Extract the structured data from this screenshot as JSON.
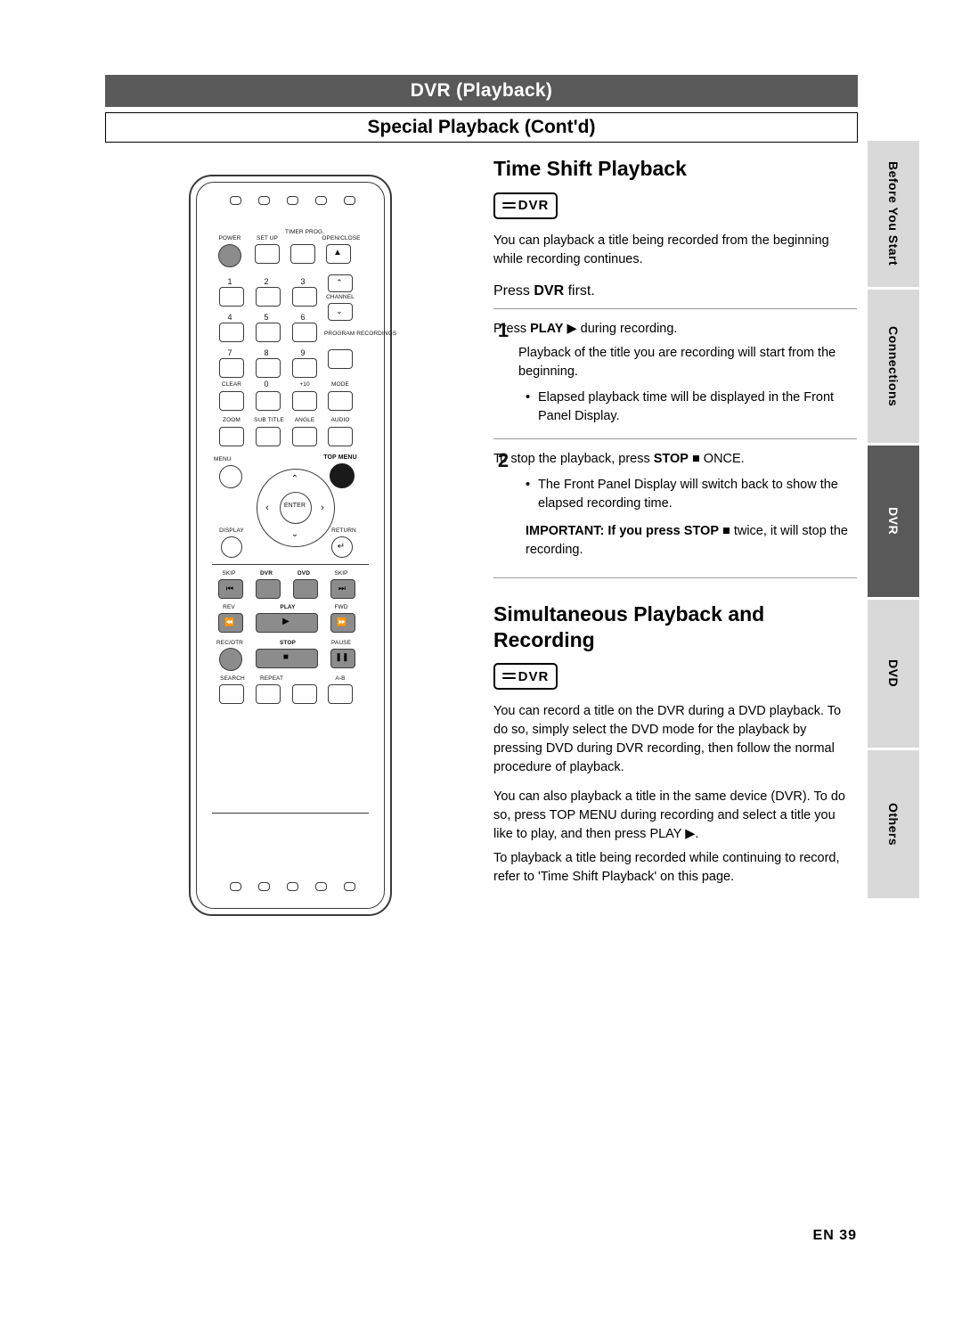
{
  "header": {
    "title": "DVR (Playback)",
    "subtitle": "Special Playback (Cont'd)"
  },
  "side_tabs": [
    {
      "label": "Before You Start",
      "style": "gray"
    },
    {
      "label": "Connections",
      "style": "gray"
    },
    {
      "label": "DVR",
      "style": "dark"
    },
    {
      "label": "DVD",
      "style": "gray"
    },
    {
      "label": "Others",
      "style": "gray"
    }
  ],
  "sections": [
    {
      "title": "Time Shift Playback",
      "badge": "DVR",
      "intro": "You can playback a title being recorded from the beginning while recording continues.",
      "press_first_pre": "Press ",
      "press_first_bold": "DVR",
      "press_first_post": " first.",
      "steps": [
        {
          "num": "1",
          "text_pre": "Press ",
          "text_bold": "PLAY",
          "text_post": " ▶ during recording.",
          "detail": "Playback of the title you are recording will start from the beginning.",
          "bullets": [
            "Elapsed playback time will be displayed in the Front Panel Display."
          ]
        },
        {
          "num": "2",
          "text_pre": "To stop the playback, press ",
          "text_bold": "STOP",
          "text_post": " ■ ONCE.",
          "detail": "",
          "bullets": [
            "The Front Panel Display will switch back to show the elapsed recording time."
          ],
          "important_pre": "IMPORTANT: If you press ",
          "important_bold": "STOP",
          "important_post": " ■ twice, it will stop the recording."
        }
      ]
    },
    {
      "title": "Simultaneous Playback and Recording",
      "badge": "DVR",
      "paragraphs": [
        "You can record a title on the DVR during a DVD playback. To do so, simply select the DVD mode for the playback by pressing DVD during DVR recording, then follow the normal procedure of playback.",
        "You can also playback a title in the same device (DVR). To do so, press TOP MENU during recording and select a title you like to play, and then press PLAY ▶.",
        "To playback a title being recorded while continuing to record, refer to 'Time Shift Playback' on this page."
      ]
    }
  ],
  "remote": {
    "name": "remote-control-illustration",
    "labels": [
      "POWER",
      "SET UP",
      "TIMER PROG.",
      "OPEN/CLOSE",
      "CHANNEL",
      "PROGRAM RECORDINGS",
      "CLEAR",
      "+10",
      "MODE",
      "ZOOM",
      "SUB TITLE",
      "ANGLE",
      "AUDIO",
      "MENU",
      "TOP MENU",
      "DISPLAY",
      "ENTER",
      "RETURN",
      "SKIP",
      "DVR",
      "DVD",
      "SKIP",
      "REV",
      "PLAY",
      "FWD",
      "REC/OTR",
      "STOP",
      "PAUSE",
      "SEARCH",
      "REPEAT",
      "A-B"
    ],
    "numbers": [
      "1",
      "2",
      "3",
      "4",
      "5",
      "6",
      "7",
      "8",
      "9",
      "0"
    ]
  },
  "footer": {
    "page": "EN   39"
  },
  "colors": {
    "header_bg": "#595959",
    "tab_gray": "#d9d9d9",
    "tab_dark": "#595959",
    "rule": "#9a9a9a"
  }
}
